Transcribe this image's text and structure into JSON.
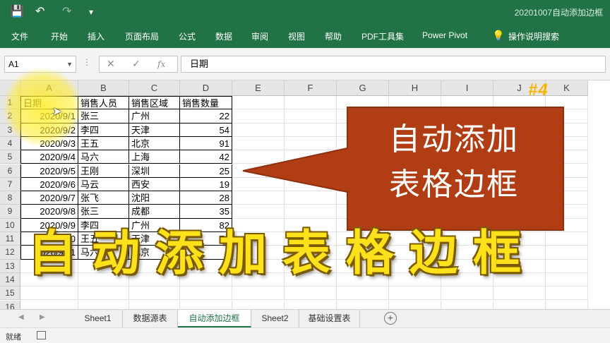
{
  "window": {
    "title": "20201007自动添加边框",
    "quick_access": {
      "save": "💾",
      "undo": "↶",
      "redo": "↷",
      "customize": "▾"
    }
  },
  "menu": [
    "文件",
    "开始",
    "插入",
    "页面布局",
    "公式",
    "数据",
    "审阅",
    "视图",
    "帮助",
    "PDF工具集",
    "Power Pivot",
    "操作说明搜索"
  ],
  "formula_bar": {
    "name_box": "A1",
    "cancel": "✕",
    "enter": "✓",
    "fx": "fx",
    "content": "日期"
  },
  "columns": [
    "A",
    "B",
    "C",
    "D",
    "E",
    "F",
    "G",
    "H",
    "I",
    "J",
    "K"
  ],
  "rows": [
    "1",
    "2",
    "3",
    "4",
    "5",
    "6",
    "7",
    "8",
    "9",
    "10",
    "11",
    "12",
    "13",
    "14",
    "15",
    "16"
  ],
  "table": {
    "headers": [
      "日期",
      "销售人员",
      "销售区域",
      "销售数量"
    ],
    "records": [
      [
        "2020/9/1",
        "张三",
        "广州",
        "22"
      ],
      [
        "2020/9/2",
        "李四",
        "天津",
        "54"
      ],
      [
        "2020/9/3",
        "王五",
        "北京",
        "91"
      ],
      [
        "2020/9/4",
        "马六",
        "上海",
        "42"
      ],
      [
        "2020/9/5",
        "王刚",
        "深圳",
        "25"
      ],
      [
        "2020/9/6",
        "马云",
        "西安",
        "19"
      ],
      [
        "2020/9/7",
        "张飞",
        "沈阳",
        "28"
      ],
      [
        "2020/9/8",
        "张三",
        "成都",
        "35"
      ],
      [
        "2020/9/9",
        "李四",
        "广州",
        "82"
      ],
      [
        "2020/9/10",
        "王五",
        "天津",
        "74"
      ],
      [
        "2020/9/11",
        "马六",
        "北京",
        "1"
      ]
    ]
  },
  "overlay": {
    "episode_tag": "#4",
    "callout_line1": "自动添加",
    "callout_line2": "表格边框",
    "big_title": "自动添加表格边框",
    "callout_color": "#b13d14",
    "title_color": "#fde21b"
  },
  "sheet_tabs": [
    "Sheet1",
    "数据源表",
    "自动添加边框",
    "Sheet2",
    "基础设置表"
  ],
  "active_sheet": "自动添加边框",
  "status": {
    "text": "就绪"
  },
  "colors": {
    "ribbon": "#217346",
    "grid_header": "#e6e6e6"
  }
}
